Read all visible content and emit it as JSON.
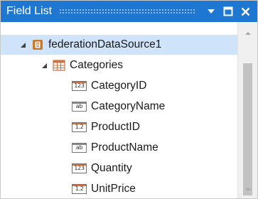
{
  "panel": {
    "title": "Field List",
    "icons": {
      "dropdown": "chevron-down-icon",
      "maximize": "maximize-icon",
      "close": "close-icon"
    }
  },
  "tree": {
    "datasource": {
      "label": "federationDataSource1",
      "icon": "database-icon",
      "expanded": true,
      "selected": true
    },
    "table": {
      "label": "Categories",
      "icon": "table-icon",
      "expanded": true
    },
    "fields": [
      {
        "label": "CategoryID",
        "type_badge": "123",
        "icon": "integer-field-icon"
      },
      {
        "label": "CategoryName",
        "type_badge": "ab",
        "icon": "string-field-icon"
      },
      {
        "label": "ProductID",
        "type_badge": "1.2",
        "icon": "decimal-field-icon"
      },
      {
        "label": "ProductName",
        "type_badge": "ab",
        "icon": "string-field-icon"
      },
      {
        "label": "Quantity",
        "type_badge": "123",
        "icon": "integer-field-icon"
      },
      {
        "label": "UnitPrice",
        "type_badge": "1.2",
        "icon": "decimal-field-icon"
      }
    ]
  },
  "colors": {
    "titlebar": "#1e78d2",
    "selection": "#cfe3fb",
    "badge_accent": "#d86b3c"
  }
}
